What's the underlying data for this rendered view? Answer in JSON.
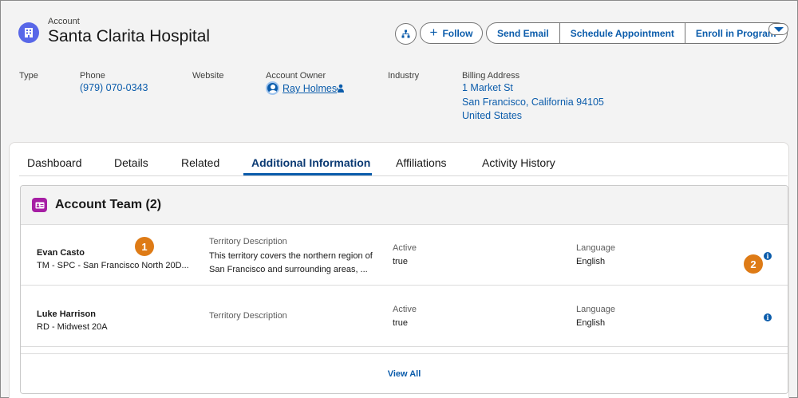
{
  "header": {
    "object_label": "Account",
    "title": "Santa Clarita Hospital",
    "follow_label": "Follow",
    "actions": [
      "Send Email",
      "Schedule Appointment",
      "Enroll in Program"
    ]
  },
  "highlights": {
    "type_label": "Type",
    "phone_label": "Phone",
    "phone_value": "(979) 070-0343",
    "website_label": "Website",
    "owner_label": "Account Owner",
    "owner_value": "Ray Holmes",
    "industry_label": "Industry",
    "billing_label": "Billing Address",
    "billing_lines": [
      "1 Market St",
      "San Francisco, California 94105",
      "United States"
    ]
  },
  "tabs": [
    "Dashboard",
    "Details",
    "Related",
    "Additional Information",
    "Affiliations",
    "Activity History"
  ],
  "active_tab": "Additional Information",
  "team": {
    "title": "Account Team (2)",
    "rows": [
      {
        "name": "Evan Casto",
        "territory": "TM - SPC - San Francisco North 20D...",
        "desc_label": "Territory Description",
        "desc_value": [
          "This territory covers the northern region of",
          "San Francisco and surrounding areas, ..."
        ],
        "active_label": "Active",
        "active_value": "true",
        "language_label": "Language",
        "language_value": "English"
      },
      {
        "name": "Luke Harrison",
        "territory": "RD - Midwest 20A",
        "desc_label": "Territory Description",
        "desc_value": [],
        "active_label": "Active",
        "active_value": "true",
        "language_label": "Language",
        "language_value": "English"
      }
    ],
    "view_all": "View All"
  },
  "callouts": [
    "1",
    "2"
  ],
  "colors": {
    "brand_blue": "#0b5cab",
    "account_icon": "#5867e8",
    "team_icon": "#a61ea4",
    "callout_orange": "#de7b16"
  },
  "icons": {
    "account": "building-icon",
    "hierarchy": "hierarchy-icon",
    "team": "contact-card-icon",
    "info": "info-icon",
    "more": "chevron-down-icon"
  }
}
